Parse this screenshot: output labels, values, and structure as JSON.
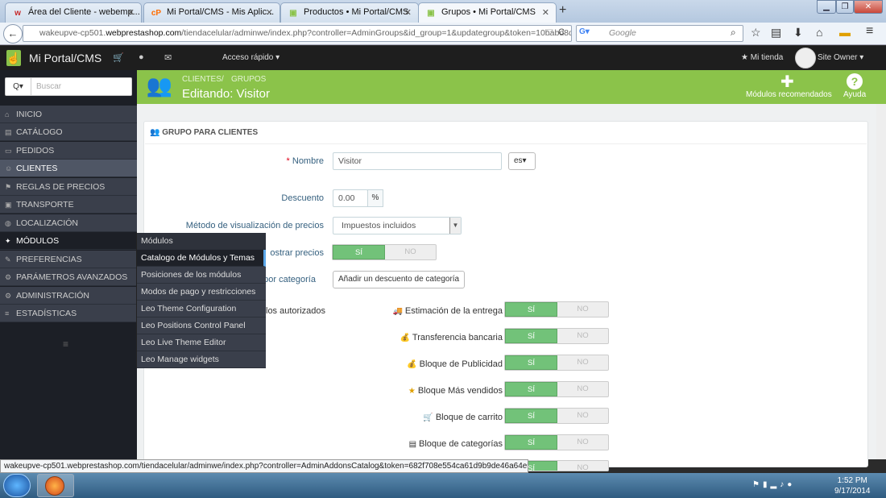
{
  "browser": {
    "tabs": [
      {
        "title": "Área del Cliente - webemp...",
        "icon": "w",
        "color": "#c62828"
      },
      {
        "title": "Mi Portal/CMS - Mis Aplic...",
        "icon": "cP",
        "color": "#ff6d00"
      },
      {
        "title": "Productos • Mi Portal/CMS",
        "icon": "▣",
        "color": "#8bc34a"
      },
      {
        "title": "Grupos • Mi Portal/CMS",
        "icon": "▣",
        "color": "#8bc34a"
      }
    ],
    "new_tab": "+",
    "url_prefix": "wakeupve-cp501.",
    "url_domain": "webprestashop.com",
    "url_rest": "/tiendacelular/adminwe/index.php?controller=AdminGroups&id_group=1&updategroup&token=10babd8dc",
    "search_placeholder": "Google"
  },
  "header": {
    "brand": "Mi Portal/CMS",
    "quick_access": "Acceso rápido ▾",
    "my_shop": "★ Mi tienda",
    "owner": "Site Owner ▾"
  },
  "sidebar": {
    "search_placeholder": "Buscar",
    "search_trigger": "Q▾",
    "items": [
      {
        "label": "INICIO",
        "icon": "⌂"
      },
      {
        "label": "CATÁLOGO",
        "icon": "▤"
      },
      {
        "label": "PEDIDOS",
        "icon": "▭"
      },
      {
        "label": "CLIENTES",
        "icon": "☺"
      },
      {
        "label": "REGLAS DE PRECIOS",
        "icon": "⚑"
      },
      {
        "label": "TRANSPORTE",
        "icon": "▣"
      },
      {
        "label": "LOCALIZACIÓN",
        "icon": "◍"
      },
      {
        "label": "MÓDULOS",
        "icon": "✦"
      },
      {
        "label": "PREFERENCIAS",
        "icon": "✎"
      },
      {
        "label": "PARÁMETROS AVANZADOS",
        "icon": "⚙"
      },
      {
        "label": "ADMINISTRACIÓN",
        "icon": "⚙"
      },
      {
        "label": "ESTADÍSTICAS",
        "icon": "≡"
      }
    ],
    "collapse": "≡",
    "flyout": [
      "Módulos",
      "Catalogo de Módulos y Temas",
      "Posiciones de los módulos",
      "Modos de pago y restricciones",
      "Leo Theme Configuration",
      "Leo Positions Control Panel",
      "Leo Live Theme Editor",
      "Leo Manage widgets"
    ]
  },
  "page": {
    "breadcrumb": [
      "CLIENTES",
      "GRUPOS"
    ],
    "breadcrumb_sep": "/",
    "title": "Editando: Visitor",
    "toolbar": {
      "modules": "Módulos recomendados",
      "help": "Ayuda"
    }
  },
  "form": {
    "panel_title": "GRUPO PARA CLIENTES",
    "name_label": "Nombre",
    "name_value": "Visitor",
    "lang": "es▾",
    "discount_label": "Descuento",
    "discount_value": "0.00",
    "discount_unit": "%",
    "price_display_label": "Método de visualización de precios",
    "price_display_value": "Impuestos incluidos",
    "show_prices_label": "ostrar precios",
    "cat_discount_label": "to por categoría",
    "cat_discount_button": "Añadir un descuento de categoría",
    "modules_label": "los autorizados",
    "yes": "SÍ",
    "no": "NO",
    "modules": [
      {
        "name": "Estimación de la entrega",
        "icon": "🚚"
      },
      {
        "name": "Transferencia bancaria",
        "icon": "💰"
      },
      {
        "name": "Bloque de Publicidad",
        "icon": "💰"
      },
      {
        "name": "Bloque Más vendidos",
        "icon": "★"
      },
      {
        "name": "Bloque de carrito",
        "icon": "🛒"
      },
      {
        "name": "Bloque de categorías",
        "icon": "▤"
      }
    ]
  },
  "statusbar": "wakeupve-cp501.webprestashop.com/tiendacelular/adminwe/index.php?controller=AdminAddonsCatalog&token=682f708e554ca61d9b9de46a64e9074b",
  "taskbar": {
    "time": "1:52 PM",
    "date": "9/17/2014"
  }
}
